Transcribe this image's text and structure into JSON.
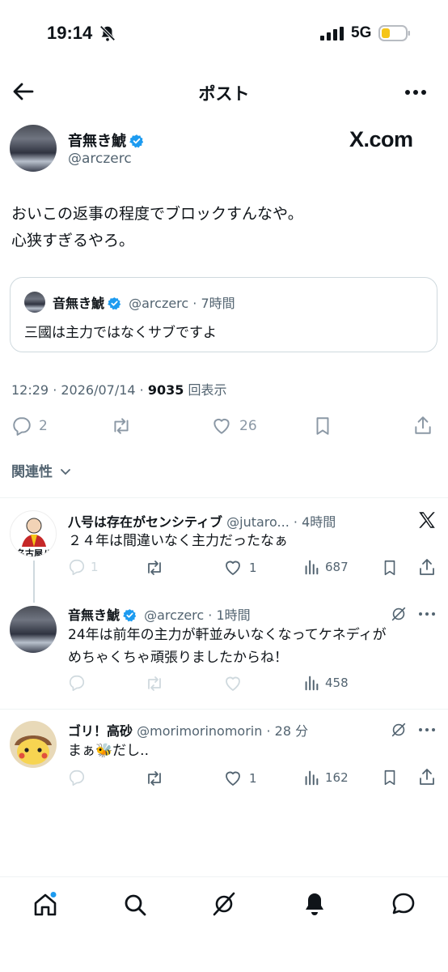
{
  "status_bar": {
    "time": "19:14",
    "network": "5G"
  },
  "header": {
    "title": "ポスト"
  },
  "post": {
    "author_name": "音無き鯱",
    "author_handle": "@arczerc",
    "watermark": "X.com",
    "text_line1": "おいこの返事の程度でブロックすんなや。",
    "text_line2": "心狭すぎるやろ。",
    "quote": {
      "author_name": "音無き鯱",
      "author_handle": "@arczerc",
      "time": "· 7時間",
      "text": "三國は主力ではなくサブですよ"
    },
    "timestamp": "12:29 · 2026/07/14 · ",
    "views_count": "9035",
    "views_label": " 回表示",
    "replies": "2",
    "likes": "26"
  },
  "related_label": "関連性",
  "replies": [
    {
      "name": "八号は存在がセンシティブ",
      "handle": "@jutaro...",
      "time": "· 4時間",
      "text": "２４年は間違いなく主力だったなぁ",
      "replies": "1",
      "likes": "1",
      "views": "687",
      "avatar_caption": "名古屋八"
    },
    {
      "name": "音無き鯱",
      "handle": "@arczerc",
      "time": "· 1時間",
      "text_line1": "24年は前年の主力が軒並みいなくなってケネディが",
      "text_line2": "めちゃくちゃ頑張りましたからね！",
      "views": "458"
    },
    {
      "name": "ゴリ！高砂",
      "handle": "@morimorinomorin",
      "time": "· 28 分",
      "text": "まぁ🐝だし..",
      "likes": "1",
      "views": "162"
    }
  ],
  "colors": {
    "verified": "#1d9bf0",
    "battery": "#f5c518",
    "notification_dot": "#1d9bf0"
  }
}
